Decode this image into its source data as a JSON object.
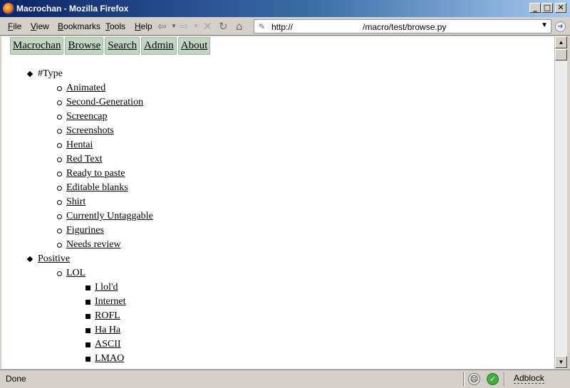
{
  "window": {
    "title": "Macrochan - Mozilla Firefox",
    "controls": {
      "minimize": "_",
      "maximize": "□",
      "close": "✕"
    }
  },
  "menubar": {
    "items": [
      {
        "label": "File",
        "mnemonic": "F",
        "rest": "ile"
      },
      {
        "label": "View",
        "mnemonic": "V",
        "rest": "iew"
      },
      {
        "label": "Bookmarks",
        "mnemonic": "B",
        "rest": "ookmarks"
      },
      {
        "label": "Tools",
        "mnemonic": "T",
        "rest": "ools"
      },
      {
        "label": "Help",
        "mnemonic": "H",
        "rest": "elp"
      }
    ],
    "nav_icons": {
      "back": "⇦",
      "forward": "⇨",
      "stop": "✕",
      "reload": "↻",
      "home": "⌂",
      "dropdown": "▼"
    }
  },
  "urlbar": {
    "scheme": "http://",
    "path": "/macro/test/browse.py",
    "page_icon": "✎",
    "dropdown": "▼",
    "go_icon": "➜"
  },
  "site_nav": [
    "Macrochan",
    "Browse",
    "Search",
    "Admin",
    "About"
  ],
  "tree": [
    {
      "level": 0,
      "text": "#Type",
      "link": false
    },
    {
      "level": 1,
      "text": "Animated",
      "link": true
    },
    {
      "level": 1,
      "text": "Second-Generation",
      "link": true
    },
    {
      "level": 1,
      "text": "Screencap",
      "link": true
    },
    {
      "level": 1,
      "text": "Screenshots",
      "link": true
    },
    {
      "level": 1,
      "text": "Hentai",
      "link": true
    },
    {
      "level": 1,
      "text": "Red Text",
      "link": true
    },
    {
      "level": 1,
      "text": "Ready to paste",
      "link": true
    },
    {
      "level": 1,
      "text": "Editable blanks",
      "link": true
    },
    {
      "level": 1,
      "text": "Shirt",
      "link": true
    },
    {
      "level": 1,
      "text": "Currently Untaggable",
      "link": true
    },
    {
      "level": 1,
      "text": "Figurines",
      "link": true
    },
    {
      "level": 1,
      "text": "Needs review",
      "link": true
    },
    {
      "level": 0,
      "text": "Positive",
      "link": true
    },
    {
      "level": 1,
      "text": "LOL",
      "link": true
    },
    {
      "level": 2,
      "text": "I lol'd",
      "link": true
    },
    {
      "level": 2,
      "text": "Internet",
      "link": true
    },
    {
      "level": 2,
      "text": "ROFL",
      "link": true
    },
    {
      "level": 2,
      "text": "Ha Ha",
      "link": true
    },
    {
      "level": 2,
      "text": "ASCII",
      "link": true
    },
    {
      "level": 2,
      "text": "LMAO",
      "link": true
    }
  ],
  "scrollbar": {
    "up": "▲",
    "down": "▼"
  },
  "statusbar": {
    "text": "Done",
    "adblock": "Adblock",
    "face_icon": "☹",
    "ok_icon": "✓"
  }
}
